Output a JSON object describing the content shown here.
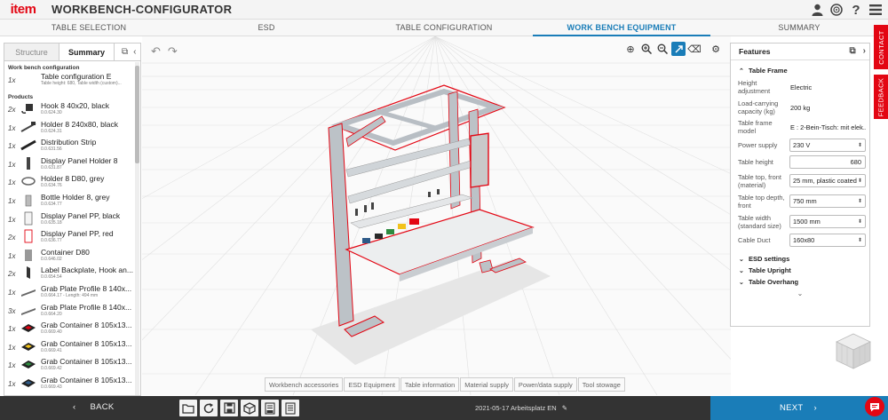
{
  "app": {
    "logo": "item",
    "title": "WORKBENCH-CONFIGURATOR"
  },
  "header_icons": [
    "user-icon",
    "globe-icon",
    "help-icon",
    "menu-icon"
  ],
  "header_help": "?",
  "steps": [
    {
      "label": "TABLE SELECTION",
      "active": false
    },
    {
      "label": "ESD",
      "active": false
    },
    {
      "label": "TABLE CONFIGURATION",
      "active": false
    },
    {
      "label": "WORK BENCH EQUIPMENT",
      "active": true
    },
    {
      "label": "SUMMARY",
      "active": false
    }
  ],
  "left_panel": {
    "tabs": {
      "structure": "Structure",
      "summary": "Summary"
    },
    "section_config": "Work bench configuration",
    "table_config": {
      "qty": "1x",
      "name": "Table configuration E",
      "sub": "Table height: 680, Table width (custom)..."
    },
    "section_products": "Products",
    "products": [
      {
        "qty": "2x",
        "name": "Hook 8 40x20, black",
        "sub": "0.0.624.30"
      },
      {
        "qty": "1x",
        "name": "Holder 8 240x80, black",
        "sub": "0.0.624.31"
      },
      {
        "qty": "1x",
        "name": "Distribution Strip",
        "sub": "0.0.631.56"
      },
      {
        "qty": "1x",
        "name": "Display Panel Holder 8",
        "sub": "0.0.631.87"
      },
      {
        "qty": "1x",
        "name": "Holder 8 D80, grey",
        "sub": "0.0.634.76"
      },
      {
        "qty": "1x",
        "name": "Bottle Holder 8, grey",
        "sub": "0.0.634.77"
      },
      {
        "qty": "1x",
        "name": "Display Panel PP, black",
        "sub": "0.0.635.18"
      },
      {
        "qty": "2x",
        "name": "Display Panel PP, red",
        "sub": "0.0.636.77"
      },
      {
        "qty": "1x",
        "name": "Container D80",
        "sub": "0.0.646.02"
      },
      {
        "qty": "2x",
        "name": "Label Backplate, Hook an...",
        "sub": "0.0.654.54"
      },
      {
        "qty": "1x",
        "name": "Grab Plate Profile 8 140x...",
        "sub": "0.0.664.17 - Length: 494 mm"
      },
      {
        "qty": "3x",
        "name": "Grab Plate Profile 8 140x...",
        "sub": "0.0.664.20"
      },
      {
        "qty": "1x",
        "name": "Grab Container 8 105x13...",
        "sub": "0.0.669.40"
      },
      {
        "qty": "1x",
        "name": "Grab Container 8 105x13...",
        "sub": "0.0.669.41"
      },
      {
        "qty": "1x",
        "name": "Grab Container 8 105x13...",
        "sub": "0.0.669.42"
      },
      {
        "qty": "1x",
        "name": "Grab Container 8 105x13...",
        "sub": "0.0.669.43"
      }
    ]
  },
  "features": {
    "title": "Features",
    "section_table_frame": "Table Frame",
    "rows": [
      {
        "label": "Height adjustment",
        "value": "Electric",
        "kind": "text"
      },
      {
        "label": "Load-carrying capacity (kg)",
        "value": "200 kg",
        "kind": "text"
      },
      {
        "label": "Table frame model",
        "value": "E : 2-Bein-Tisch: mit elek...",
        "kind": "text"
      },
      {
        "label": "Power supply",
        "value": "230 V",
        "kind": "select"
      },
      {
        "label": "Table height",
        "value": "680",
        "kind": "input"
      },
      {
        "label": "Table top, front (material)",
        "value": "25 mm, plastic coated",
        "kind": "select"
      },
      {
        "label": "Table top depth, front",
        "value": "750 mm",
        "kind": "select"
      },
      {
        "label": "Table width (standard size)",
        "value": "1500 mm",
        "kind": "select"
      },
      {
        "label": "Cable Duct",
        "value": "160x80",
        "kind": "select"
      }
    ],
    "collapsed_sections": [
      "ESD settings",
      "Table Upright",
      "Table Overhang"
    ]
  },
  "side_tabs": {
    "contact": "CONTACT",
    "feedback": "FEEDBACK"
  },
  "category_tabs": [
    "Workbench accessories",
    "ESD Equipment",
    "Table information",
    "Material supply",
    "Power/data supply",
    "Tool stowage"
  ],
  "bottom": {
    "back": "BACK",
    "next": "NEXT",
    "filename": "2021-05-17 Arbeitsplatz EN"
  },
  "colors": {
    "brand_red": "#e30613",
    "accent_blue": "#1a7db8",
    "bottom_bar": "#333333"
  }
}
